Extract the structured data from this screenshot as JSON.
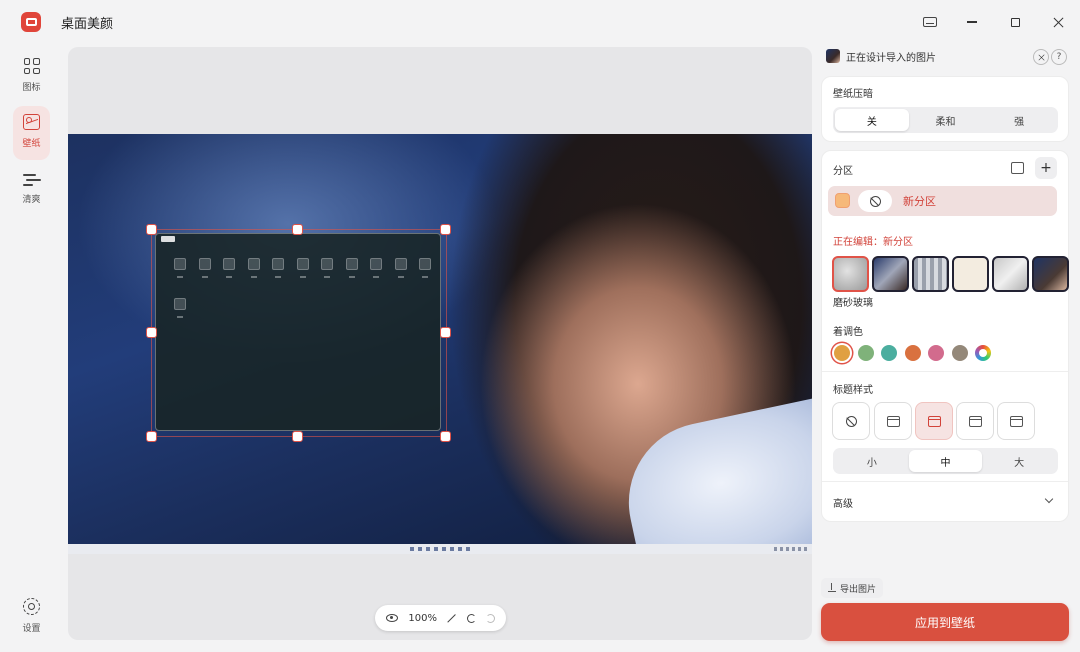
{
  "app": {
    "title": "桌面美颜"
  },
  "nav": {
    "items": [
      {
        "label": "图标",
        "icon": "grid-icon",
        "active": false
      },
      {
        "label": "壁纸",
        "icon": "image-icon",
        "active": true
      },
      {
        "label": "清爽",
        "icon": "wind-icon",
        "active": false
      }
    ],
    "settings_label": "设置"
  },
  "canvas": {
    "zoom": "100%"
  },
  "panel": {
    "header_text": "正在设计导入的图片",
    "help": "?",
    "compress": {
      "title": "壁纸压暗",
      "options": [
        "关",
        "柔和",
        "强"
      ],
      "selected": "关"
    },
    "sections": {
      "title": "分区",
      "add": "+",
      "item_label": "新分区",
      "editing_label": "正在编辑：新分区",
      "material_label": "磨砂玻璃",
      "tint_title": "着调色",
      "tint_colors": [
        "#e0a042",
        "#7fb27a",
        "#4bae9f",
        "#d9713f",
        "#d26b8d",
        "#948879"
      ],
      "title_style": {
        "title": "标题样式",
        "size_options": [
          "小",
          "中",
          "大"
        ],
        "size_selected": "中"
      },
      "advanced_label": "高级"
    }
  },
  "actions": {
    "export_label": "导出图片",
    "apply_label": "应用到壁纸"
  },
  "colors": {
    "accent": "#d9503f",
    "accent_soft": "#f6e3e2"
  }
}
